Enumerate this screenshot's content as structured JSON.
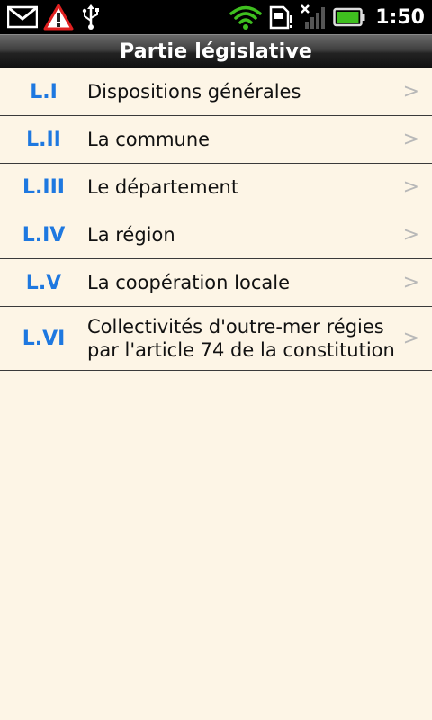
{
  "status_bar": {
    "time": "1:50",
    "icons": [
      "gmail-icon",
      "warning-icon",
      "usb-icon",
      "wifi-icon",
      "sim-icon",
      "signal-icon",
      "battery-icon"
    ]
  },
  "header": {
    "title": "Partie législative"
  },
  "items": [
    {
      "code": "L.I",
      "label": "Dispositions générales",
      "chevron": ">"
    },
    {
      "code": "L.II",
      "label": "La commune",
      "chevron": ">"
    },
    {
      "code": "L.III",
      "label": "Le département",
      "chevron": ">"
    },
    {
      "code": "L.IV",
      "label": "La région",
      "chevron": ">"
    },
    {
      "code": "L.V",
      "label": "La coopération locale",
      "chevron": ">"
    },
    {
      "code": "L.VI",
      "label": "Collectivités d'outre-mer régies\npar l'article 74 de la constitution",
      "chevron": ">"
    }
  ],
  "colors": {
    "background": "#fdf5e6",
    "code": "#1e78e0",
    "divider": "#3a3a3a",
    "battery": "#3fbf1f",
    "wifi": "#3fbf1f",
    "warning": "#e02020"
  }
}
